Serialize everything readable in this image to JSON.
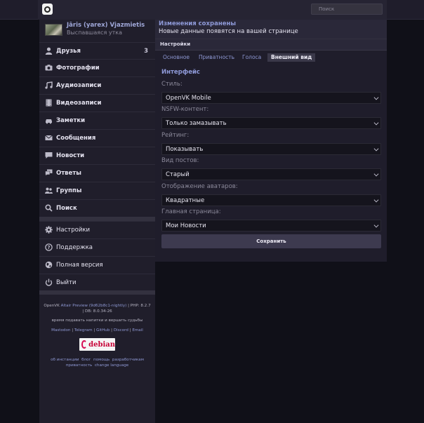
{
  "header": {
    "search_placeholder": "Поиск"
  },
  "user": {
    "name": "Jāris (yarex) Vjazmietis",
    "status": "Выспавшаяся утка"
  },
  "nav": {
    "friends": {
      "label": "Друзья",
      "count": "3",
      "icon": "person-icon"
    },
    "photos": {
      "label": "Фотографии",
      "icon": "camera-icon"
    },
    "audio": {
      "label": "Аудиозаписи",
      "icon": "music-note-icon"
    },
    "video": {
      "label": "Видеозаписи",
      "icon": "film-icon"
    },
    "notes": {
      "label": "Заметки",
      "icon": "car-icon"
    },
    "messages": {
      "label": "Сообщения",
      "icon": "envelope-icon"
    },
    "news": {
      "label": "Новости",
      "icon": "speech-bubble-icon"
    },
    "replies": {
      "label": "Ответы",
      "icon": "chat-bubbles-icon"
    },
    "groups": {
      "label": "Группы",
      "icon": "people-icon"
    },
    "search": {
      "label": "Поиск",
      "icon": "search-icon"
    },
    "settings": {
      "label": "Настройки",
      "icon": "gear-icon"
    },
    "support": {
      "label": "Поддержка",
      "icon": "help-icon"
    },
    "full_version": {
      "label": "Полная версия",
      "icon": "globe-icon"
    },
    "logout": {
      "label": "Выйти",
      "icon": "power-icon"
    }
  },
  "footer": {
    "version_prefix": "OpenVK",
    "version_link": "Altair Preview (9d62b8c1-nightly)",
    "php": "| PHP: 8.2.7",
    "db": "| DB: 8.0.34-26",
    "motto": "время подавать напитки и вершить судьбы",
    "social": [
      "Mastodon",
      "Telegram",
      "GitHub",
      "Discord",
      "Email"
    ],
    "links_row1": [
      "об инстанции",
      "блог",
      "помощь",
      "разработчикам"
    ],
    "links_row2": [
      "приватность",
      "change language"
    ],
    "badge": "debian"
  },
  "notice": {
    "title": "Изменения сохранены",
    "text": "Новые данные появятся на вашей странице"
  },
  "settings": {
    "header": "Настройки",
    "tabs": [
      "Основное",
      "Приватность",
      "Голоса",
      "Внешний вид"
    ],
    "active_tab": "Внешний вид",
    "section_title": "Интерфейс",
    "fields": [
      {
        "label": "Стиль:",
        "value": "OpenVK Mobile"
      },
      {
        "label": "NSFW-контент:",
        "value": "Только замазывать"
      },
      {
        "label": "Рейтинг:",
        "value": "Показывать"
      },
      {
        "label": "Вид постов:",
        "value": "Старый"
      },
      {
        "label": "Отображение аватаров:",
        "value": "Квадратные"
      },
      {
        "label": "Главная страница:",
        "value": "Мои Новости"
      }
    ],
    "save_label": "Сохранить"
  }
}
